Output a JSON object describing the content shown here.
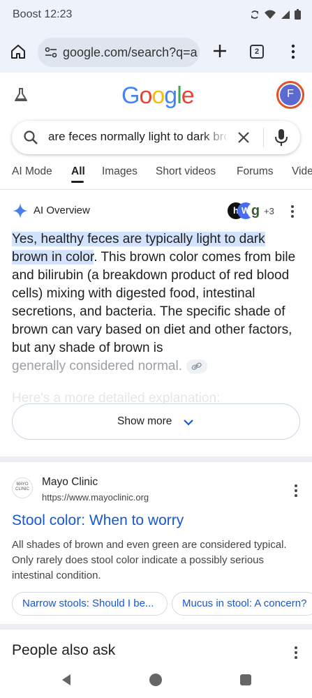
{
  "status": {
    "carrier": "Boost",
    "time": "12:23"
  },
  "browser": {
    "url": "google.com/search?q=a",
    "tab_count": "2"
  },
  "google": {
    "logo": [
      "G",
      "o",
      "o",
      "g",
      "l",
      "e"
    ],
    "logo_colors": [
      "#4285F4",
      "#EA4335",
      "#FBBC05",
      "#4285F4",
      "#34A853",
      "#EA4335"
    ],
    "avatar_letter": "F"
  },
  "search": {
    "query": "are feces normally light to dark brown in color"
  },
  "tabs": [
    "AI Mode",
    "All",
    "Images",
    "Short videos",
    "Forums",
    "Vide"
  ],
  "ai_overview": {
    "label": "AI Overview",
    "sources": {
      "letters": [
        "h",
        "W",
        "g"
      ],
      "count": "+3"
    },
    "highlight": "Yes, healthy feces are typically light to dark brown in color",
    "body": ". This brown color comes from bile and bilirubin (a breakdown product of red blood cells) mixing with digested food, intestinal secretions, and bacteria. The specific shade of brown can vary based on diet and other factors, but any shade of brown is",
    "faded_end": "generally considered normal.",
    "ghost_line": "Here's a more detailed explanation:",
    "show_more": "Show more"
  },
  "result": {
    "favicon_text": "MAYO CLINIC",
    "site": "Mayo Clinic",
    "url": "https://www.mayoclinic.org",
    "title": "Stool color: When to worry",
    "snippet": "All shades of brown and even green are considered typical. Only rarely does stool color indicate a possibly serious intestinal condition.",
    "chips": [
      "Narrow stools: Should I be...",
      "Mucus in stool: A concern?"
    ]
  },
  "paa": {
    "title": "People also ask"
  }
}
